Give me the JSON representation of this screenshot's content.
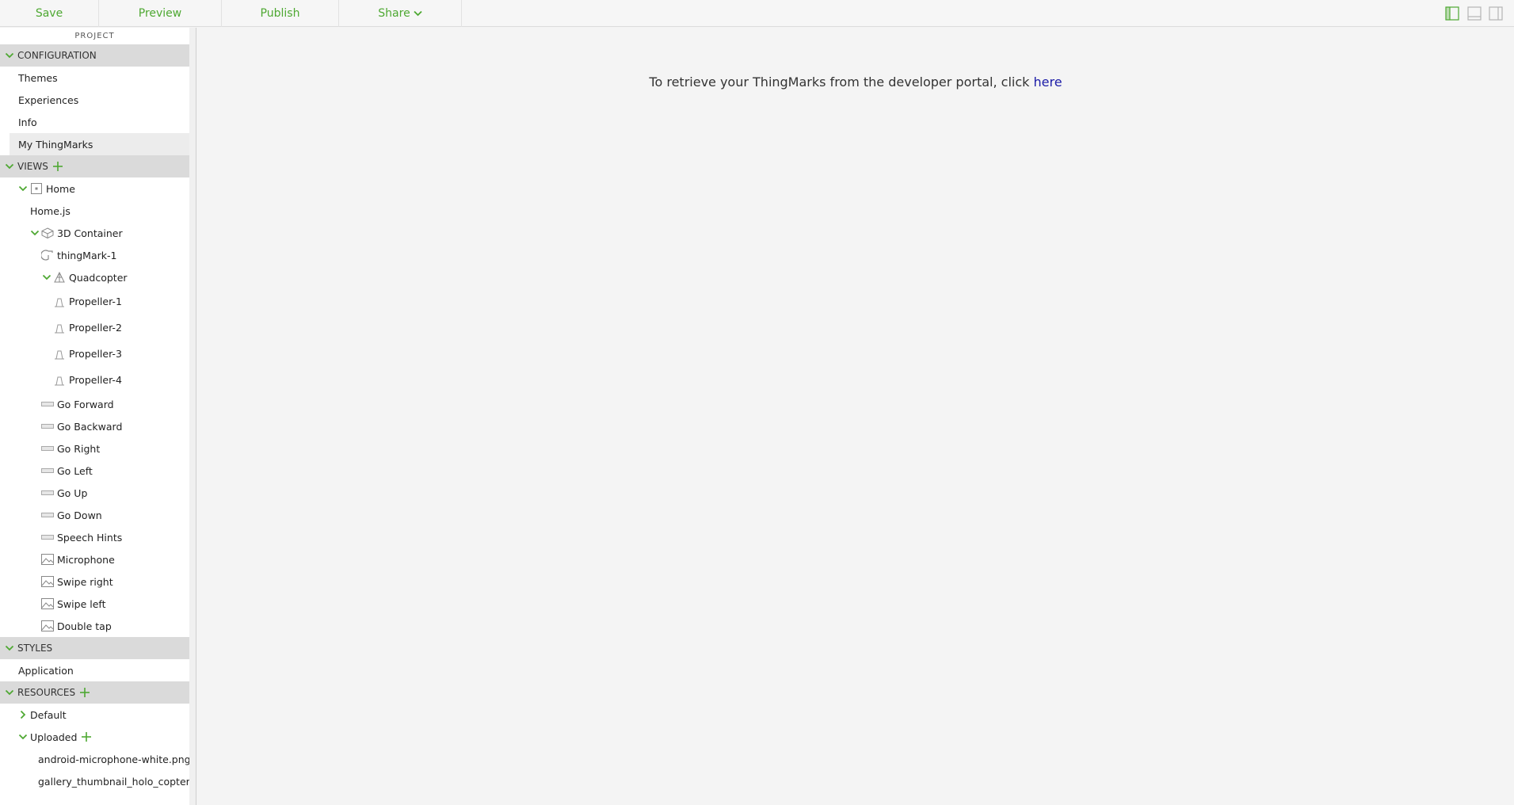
{
  "toolbar": {
    "save_label": "Save",
    "preview_label": "Preview",
    "publish_label": "Publish",
    "share_label": "Share"
  },
  "sidebar": {
    "project_title": "PROJECT",
    "configuration": {
      "label": "CONFIGURATION",
      "items": [
        "Themes",
        "Experiences",
        "Info",
        "My ThingMarks"
      ]
    },
    "views": {
      "label": "VIEWS",
      "home": "Home",
      "home_js": "Home.js",
      "container": "3D Container",
      "thingmark": "thingMark-1",
      "quadcopter": "Quadcopter",
      "propellers": [
        "Propeller-1",
        "Propeller-2",
        "Propeller-3",
        "Propeller-4"
      ],
      "labels": [
        "Go Forward",
        "Go Backward",
        "Go Right",
        "Go Left",
        "Go Up",
        "Go Down",
        "Speech Hints"
      ],
      "images": [
        "Microphone",
        "Swipe right",
        "Swipe left",
        "Double tap"
      ]
    },
    "styles": {
      "label": "STYLES",
      "items": [
        "Application"
      ]
    },
    "resources": {
      "label": "RESOURCES",
      "default": "Default",
      "uploaded": "Uploaded",
      "files": [
        "android-microphone-white.png",
        "gallery_thumbnail_holo_copter.png"
      ]
    }
  },
  "main": {
    "message": "To retrieve your ThingMarks from the developer portal, click",
    "link": "here"
  },
  "colors": {
    "accent": "#4ea832",
    "link": "#1a1aa6",
    "section_bg": "#dadada",
    "selected_bg": "#ececec"
  }
}
